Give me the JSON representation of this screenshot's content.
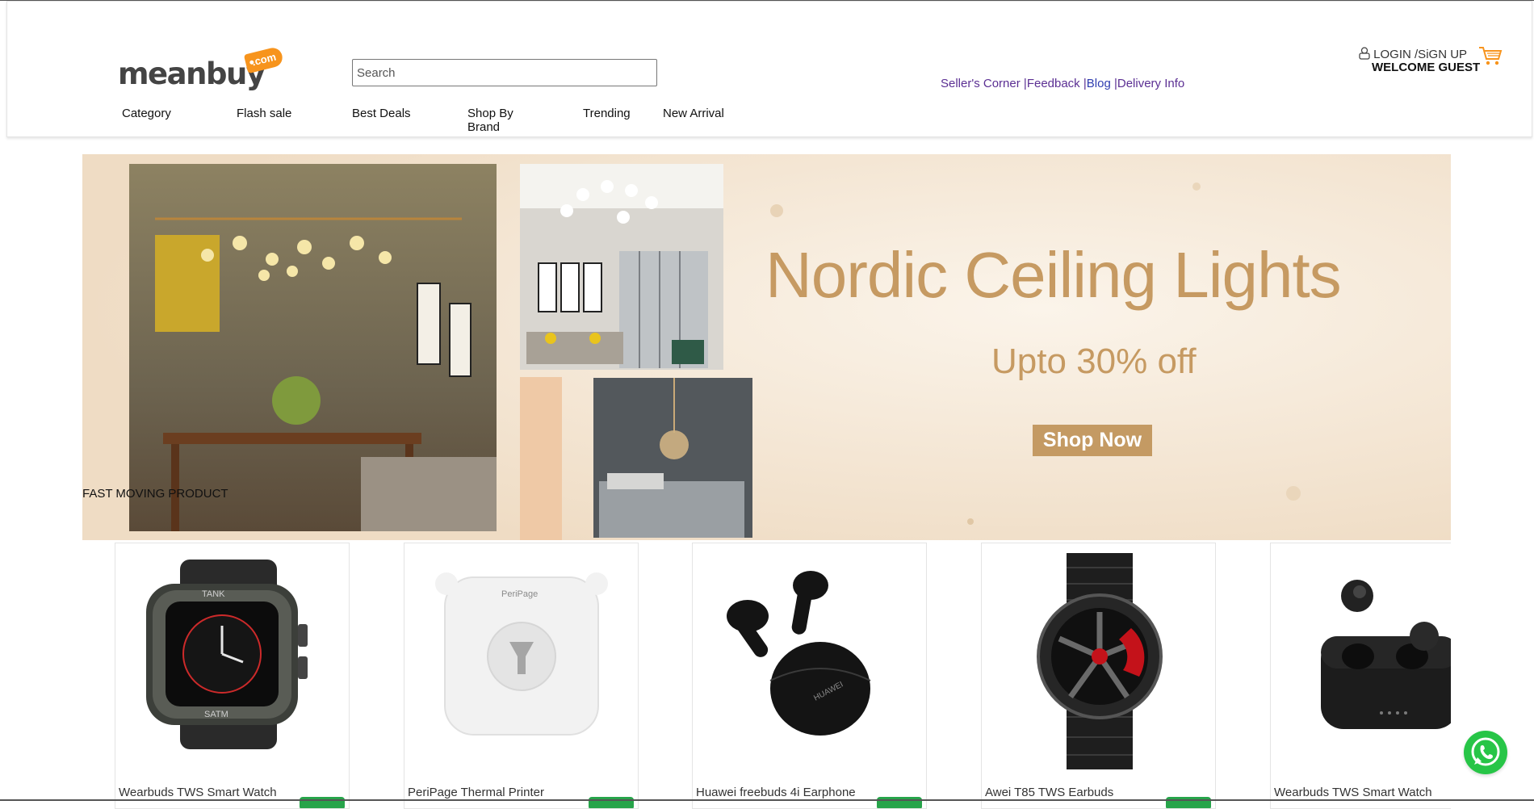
{
  "brand": {
    "logo_word": "meanbuy",
    "logo_tag": ".com"
  },
  "search": {
    "placeholder": "Search"
  },
  "nav": {
    "items": [
      "Category",
      "Flash sale",
      "Best Deals",
      "Shop By Brand",
      "Trending",
      "New Arrival"
    ]
  },
  "links": {
    "items": [
      "Seller's Corner",
      "Feedback",
      "Blog",
      "Delivery Info"
    ]
  },
  "account": {
    "login": "LOGIN /SiGN UP",
    "welcome": "WELCOME GUEST",
    "cart_icon": "cart-icon"
  },
  "banner": {
    "title": "Nordic Ceiling Lights",
    "subtitle": "Upto 30% off",
    "button": "Shop Now",
    "section_label": "FAST MOVING PRODUCT",
    "accent_color": "#c69a62"
  },
  "products": [
    {
      "name": "Wearbuds TWS Smart Watch",
      "icon": "smartwatch-image"
    },
    {
      "name": "PeriPage Thermal Printer",
      "icon": "printer-image"
    },
    {
      "name": "Huawei freebuds 4i Earphone",
      "icon": "earbuds-image"
    },
    {
      "name": "Awei T85 TWS Earbuds",
      "icon": "wristwatch-image"
    },
    {
      "name": "Wearbuds TWS Smart Watch",
      "icon": "earbuds-case-image"
    }
  ],
  "colors": {
    "link": "#5b2f93",
    "cart": "#f7941d",
    "rating": "#27a44a",
    "whatsapp": "#27c547"
  },
  "floating": {
    "whatsapp_icon": "whatsapp-icon"
  }
}
